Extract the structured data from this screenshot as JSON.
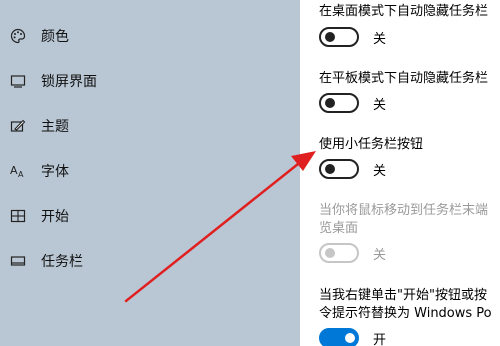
{
  "sidebar": {
    "items": [
      {
        "label": "颜色",
        "icon": "palette-icon"
      },
      {
        "label": "锁屏界面",
        "icon": "lock-screen-icon"
      },
      {
        "label": "主题",
        "icon": "theme-brush-icon"
      },
      {
        "label": "字体",
        "icon": "font-icon"
      },
      {
        "label": "开始",
        "icon": "start-grid-icon"
      },
      {
        "label": "任务栏",
        "icon": "taskbar-icon"
      }
    ]
  },
  "settings": {
    "auto_hide_desktop": {
      "title": "在桌面模式下自动隐藏任务栏",
      "state": "关"
    },
    "auto_hide_tablet": {
      "title": "在平板模式下自动隐藏任务栏",
      "state": "关"
    },
    "small_buttons": {
      "title": "使用小任务栏按钮",
      "state": "关"
    },
    "peek": {
      "title_line1": "当你将鼠标移动到任务栏末端",
      "title_line2": "览桌面",
      "state": "关"
    },
    "powershell": {
      "title_line1": "当我右键单击\"开始\"按钮或按",
      "title_line2": "令提示符替换为 Windows Po",
      "state": "开"
    }
  },
  "colors": {
    "sidebar_bg": "#b9c7d4",
    "arrow": "#e02020",
    "toggle_on": "#0078d7"
  }
}
